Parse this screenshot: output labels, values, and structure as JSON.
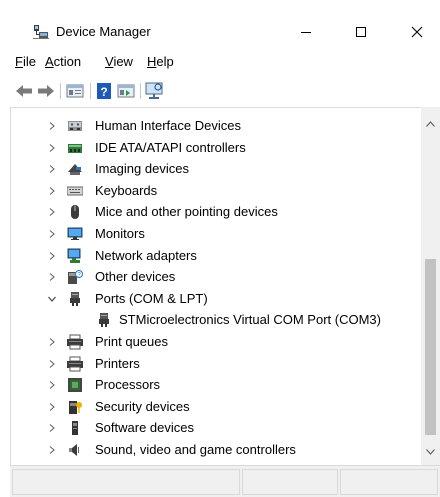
{
  "window": {
    "title": "Device Manager",
    "minimize_glyph": "—",
    "maximize_glyph": "☐",
    "close_glyph": "✕"
  },
  "menu": {
    "file": {
      "hotkey": "F",
      "rest": "ile"
    },
    "action": {
      "hotkey": "A",
      "rest": "ction"
    },
    "view": {
      "hotkey": "V",
      "rest": "iew"
    },
    "help": {
      "hotkey": "H",
      "rest": "elp"
    }
  },
  "toolbar": {
    "icons": [
      "back-arrow-icon",
      "forward-arrow-icon",
      "properties-icon",
      "help-icon",
      "view-icon",
      "monitor-icon"
    ]
  },
  "tree": {
    "items": [
      {
        "label": "Human Interface Devices",
        "icon": "hid-icon",
        "expanded": false,
        "child": false
      },
      {
        "label": "IDE ATA/ATAPI controllers",
        "icon": "ide-controller-icon",
        "expanded": false,
        "child": false
      },
      {
        "label": "Imaging devices",
        "icon": "imaging-icon",
        "expanded": false,
        "child": false
      },
      {
        "label": "Keyboards",
        "icon": "keyboard-icon",
        "expanded": false,
        "child": false
      },
      {
        "label": "Mice and other pointing devices",
        "icon": "mouse-icon",
        "expanded": false,
        "child": false
      },
      {
        "label": "Monitors",
        "icon": "monitor-icon",
        "expanded": false,
        "child": false
      },
      {
        "label": "Network adapters",
        "icon": "network-adapter-icon",
        "expanded": false,
        "child": false
      },
      {
        "label": "Other devices",
        "icon": "other-devices-icon",
        "expanded": false,
        "child": false
      },
      {
        "label": "Ports (COM & LPT)",
        "icon": "port-icon",
        "expanded": true,
        "child": false
      },
      {
        "label": "STMicroelectronics Virtual COM Port (COM3)",
        "icon": "port-icon",
        "expanded": false,
        "child": true
      },
      {
        "label": "Print queues",
        "icon": "printer-icon",
        "expanded": false,
        "child": false
      },
      {
        "label": "Printers",
        "icon": "printer-icon",
        "expanded": false,
        "child": false
      },
      {
        "label": "Processors",
        "icon": "processor-icon",
        "expanded": false,
        "child": false
      },
      {
        "label": "Security devices",
        "icon": "security-icon",
        "expanded": false,
        "child": false
      },
      {
        "label": "Software devices",
        "icon": "software-device-icon",
        "expanded": false,
        "child": false
      },
      {
        "label": "Sound, video and game controllers",
        "icon": "sound-icon",
        "expanded": false,
        "child": false
      }
    ]
  },
  "colors": {
    "accent_blue": "#1e78d7",
    "scrollbar_thumb": "#c2c2c2",
    "status_bg": "#f0f0f0"
  }
}
